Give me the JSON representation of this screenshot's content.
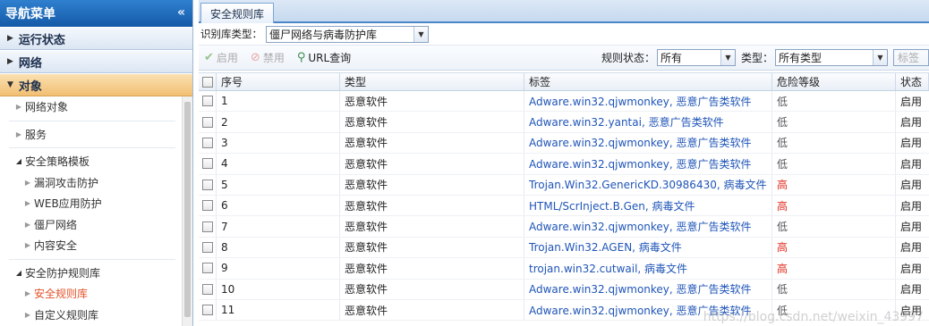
{
  "sidebar": {
    "title": "导航菜单",
    "collapse_icon": "double-chevron-left-icon",
    "sections": [
      {
        "label": "运行状态",
        "active": false
      },
      {
        "label": "网络",
        "active": false
      },
      {
        "label": "对象",
        "active": true
      }
    ],
    "items": [
      {
        "label": "网络对象",
        "level": 1
      },
      {
        "label": "服务",
        "level": 1
      },
      {
        "label": "安全策略模板",
        "level": 1
      },
      {
        "label": "漏洞攻击防护",
        "level": 2
      },
      {
        "label": "WEB应用防护",
        "level": 2
      },
      {
        "label": "僵尸网络",
        "level": 2
      },
      {
        "label": "内容安全",
        "level": 2
      },
      {
        "label": "安全防护规则库",
        "level": 1
      },
      {
        "label": "安全规则库",
        "level": 2
      },
      {
        "label": "自定义规则库",
        "level": 2
      }
    ]
  },
  "tabs": [
    {
      "label": "安全规则库",
      "active": true
    }
  ],
  "filter": {
    "label": "识别库类型：",
    "value": "僵尸网络与病毒防护库"
  },
  "toolbar": {
    "enable_label": "启用",
    "disable_label": "禁用",
    "url_query_label": "URL查询",
    "rule_status_label": "规则状态：",
    "rule_status_value": "所有",
    "type_label": "类型：",
    "type_value": "所有类型",
    "tag_placeholder": "标签"
  },
  "table": {
    "columns": [
      "序号",
      "类型",
      "标签",
      "危险等级",
      "状态"
    ],
    "rows": [
      {
        "no": "1",
        "type": "恶意软件",
        "tag": "Adware.win32.qjwmonkey, 恶意广告类软件",
        "risk": "低",
        "state": "启用"
      },
      {
        "no": "2",
        "type": "恶意软件",
        "tag": "Adware.win32.yantai, 恶意广告类软件",
        "risk": "低",
        "state": "启用"
      },
      {
        "no": "3",
        "type": "恶意软件",
        "tag": "Adware.win32.qjwmonkey, 恶意广告类软件",
        "risk": "低",
        "state": "启用"
      },
      {
        "no": "4",
        "type": "恶意软件",
        "tag": "Adware.win32.qjwmonkey, 恶意广告类软件",
        "risk": "低",
        "state": "启用"
      },
      {
        "no": "5",
        "type": "恶意软件",
        "tag": "Trojan.Win32.GenericKD.30986430, 病毒文件",
        "risk": "高",
        "state": "启用"
      },
      {
        "no": "6",
        "type": "恶意软件",
        "tag": "HTML/ScrInject.B.Gen, 病毒文件",
        "risk": "高",
        "state": "启用"
      },
      {
        "no": "7",
        "type": "恶意软件",
        "tag": "Adware.win32.qjwmonkey, 恶意广告类软件",
        "risk": "低",
        "state": "启用"
      },
      {
        "no": "8",
        "type": "恶意软件",
        "tag": "Trojan.Win32.AGEN, 病毒文件",
        "risk": "高",
        "state": "启用"
      },
      {
        "no": "9",
        "type": "恶意软件",
        "tag": "trojan.win32.cutwail, 病毒文件",
        "risk": "高",
        "state": "启用"
      },
      {
        "no": "10",
        "type": "恶意软件",
        "tag": "Adware.win32.qjwmonkey, 恶意广告类软件",
        "risk": "低",
        "state": "启用"
      },
      {
        "no": "11",
        "type": "恶意软件",
        "tag": "Adware.win32.qjwmonkey, 恶意广告类软件",
        "risk": "低",
        "state": "启用"
      }
    ]
  },
  "watermark": "https://blog.csdn.net/weixin_43997",
  "colors": {
    "accent": "#1f5fae",
    "risk_high": "#e02b1d",
    "link": "#1f55b8",
    "active_section": "#f1bf73"
  }
}
